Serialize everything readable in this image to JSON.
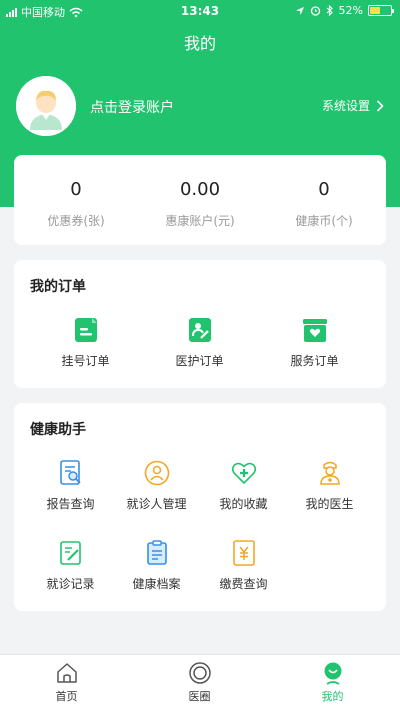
{
  "status_bar": {
    "carrier": "中国移动",
    "time": "13:43",
    "battery": "52%",
    "battery_level": 0.52
  },
  "header": {
    "title": "我的"
  },
  "profile": {
    "login_text": "点击登录账户",
    "settings_label": "系统设置"
  },
  "stats": [
    {
      "value": "0",
      "label": "优惠券(张)"
    },
    {
      "value": "0.00",
      "label": "惠康账户(元)"
    },
    {
      "value": "0",
      "label": "健康币(个)"
    }
  ],
  "orders": {
    "title": "我的订单",
    "items": [
      {
        "label": "挂号订单",
        "icon": "registration-order-icon"
      },
      {
        "label": "医护订单",
        "icon": "nursing-order-icon"
      },
      {
        "label": "服务订单",
        "icon": "service-order-icon"
      }
    ]
  },
  "helper": {
    "title": "健康助手",
    "items": [
      {
        "label": "报告查询",
        "icon": "report-query-icon"
      },
      {
        "label": "就诊人管理",
        "icon": "patient-management-icon"
      },
      {
        "label": "我的收藏",
        "icon": "favorites-icon"
      },
      {
        "label": "我的医生",
        "icon": "my-doctor-icon"
      },
      {
        "label": "就诊记录",
        "icon": "visit-record-icon"
      },
      {
        "label": "健康档案",
        "icon": "health-file-icon"
      },
      {
        "label": "缴费查询",
        "icon": "payment-query-icon"
      }
    ]
  },
  "tabs": [
    {
      "label": "首页",
      "icon": "home-icon"
    },
    {
      "label": "医圈",
      "icon": "circle-icon"
    },
    {
      "label": "我的",
      "icon": "profile-icon"
    }
  ],
  "colors": {
    "brand": "#22c36f",
    "orange": "#f5a623",
    "blue": "#3a8ee6",
    "battery": "#f5e04a"
  }
}
